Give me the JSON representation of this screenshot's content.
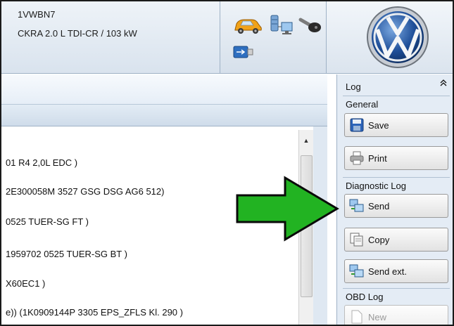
{
  "vehicle": {
    "id": "1VWBN7",
    "engine": "CKRA 2.0 L TDI-CR / 103 kW"
  },
  "header_icons": [
    "car-icon",
    "database-network-icon",
    "key-icon",
    "usb-connector-icon"
  ],
  "brand_logo": "vw-logo",
  "content_rows": [
    "01   R4 2,0L EDC  )",
    "2E300058M    3527   GSG DSG AG6    512)",
    "0525   TUER-SG FT  )",
    "1959702    0525   TUER-SG BT  )",
    "X60EC1  )",
    "e)) (1K0909144P     3305   EPS_ZFLS Kl. 290  )"
  ],
  "log_panel": {
    "title": "Log",
    "collapse_icon": "double-chevron-up-icon",
    "general": {
      "label": "General",
      "buttons": [
        {
          "label": "Save",
          "icon": "floppy-disk-icon"
        },
        {
          "label": "Print",
          "icon": "printer-icon"
        }
      ]
    },
    "diagnostic_log": {
      "label": "Diagnostic Log",
      "buttons": [
        {
          "label": "Send",
          "icon": "send-network-icon"
        },
        {
          "label": "Copy",
          "icon": "copy-icon"
        },
        {
          "label": "Send ext.",
          "icon": "send-network-icon"
        }
      ]
    },
    "obd_log": {
      "label": "OBD Log",
      "buttons": [
        {
          "label": "New",
          "icon": "new-document-icon",
          "disabled": true
        }
      ]
    }
  },
  "colors": {
    "callout_arrow": "#22b322",
    "panel_bg": "#e4ecf5",
    "header_bg": "#dde6f0"
  }
}
